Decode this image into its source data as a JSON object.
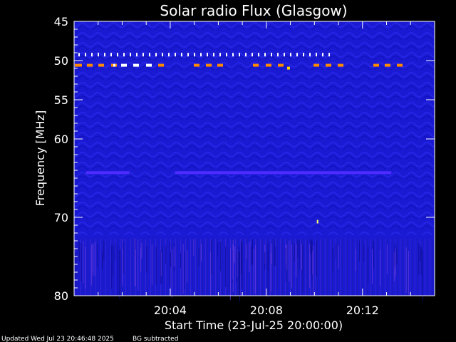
{
  "chart_data": {
    "type": "heatmap",
    "title": "Solar radio Flux (Glasgow)",
    "xlabel": "Start Time (23-Jul-25 20:00:00)",
    "ylabel": "Frequency [MHz]",
    "xlim_minutes": [
      0,
      15
    ],
    "ylim": [
      45,
      80
    ],
    "y_ticks": [
      45,
      50,
      55,
      60,
      70,
      80
    ],
    "x_tick_labels": [
      {
        "minute": 4,
        "label": "20:04"
      },
      {
        "minute": 8,
        "label": "20:08"
      },
      {
        "minute": 12,
        "label": "20:12"
      }
    ],
    "background_color": "#1a1ad2",
    "features": {
      "dotted_row_mhz": 49.2,
      "orange_row_mhz": 50.6,
      "band_mhz": 64.3,
      "band_segments_minutes": [
        [
          0.5,
          2.3
        ],
        [
          4.2,
          13.2
        ]
      ],
      "speck_minutes": [
        10.1
      ],
      "speck_mhz": [
        70.6
      ]
    },
    "colors": {
      "band": "#4f2bff",
      "orange": "#ff8a00",
      "speck": "#ffff60"
    }
  },
  "footer": {
    "updated": "Updated Wed Jul 23 20:46:48 2025",
    "note": "BG subtracted"
  }
}
